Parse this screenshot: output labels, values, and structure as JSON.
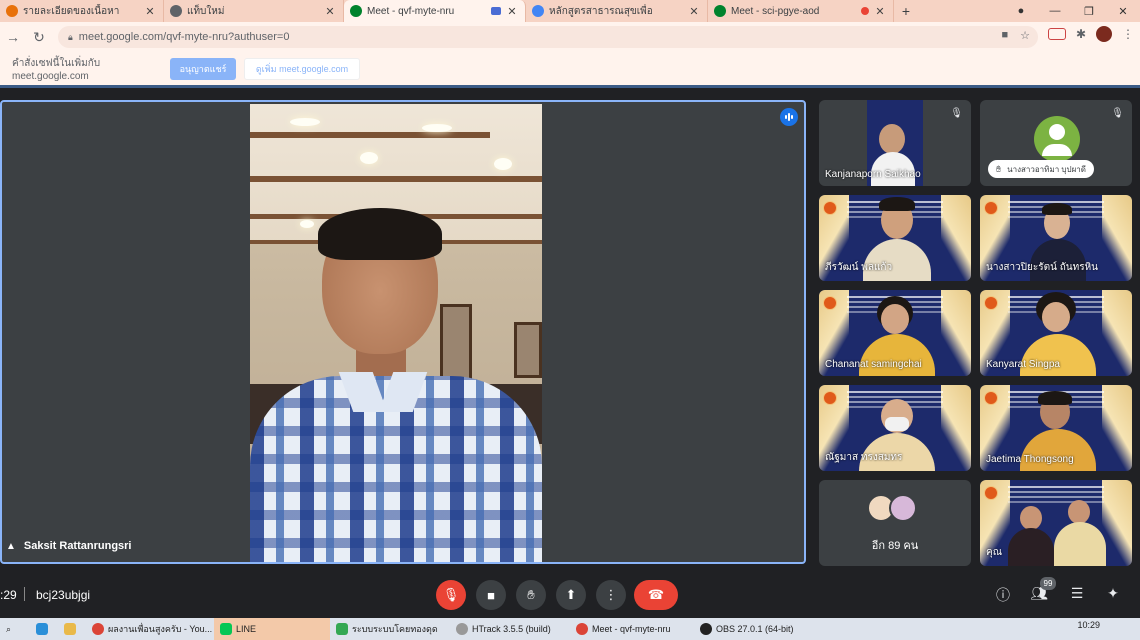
{
  "browser": {
    "tabs": [
      {
        "title": "รายละเอียดของเนื้อหา",
        "active": false,
        "favicon_color": "#e8710a"
      },
      {
        "title": "แท็บใหม่",
        "active": false,
        "favicon_color": "#5f6368"
      },
      {
        "title": "Meet - qvf-myte-nru",
        "active": true,
        "favicon_color": "#00832d"
      },
      {
        "title": "หลักสูตรสาธารณสุขเพื่อ",
        "active": false,
        "favicon_color": "#4285f4"
      },
      {
        "title": "Meet - sci-pgye-aod",
        "active": false,
        "favicon_color": "#00832d"
      }
    ],
    "new_tab": "+",
    "url": "meet.google.com/qvf-myte-nru?authuser=0",
    "infobar": {
      "message": "คำสั่งเซฟนี้ในเพิ่มกับ meet.google.com",
      "save_label": "อนุญาตแชร์",
      "never_label": "ดูเพิ่ม meet.google.com"
    }
  },
  "meet": {
    "main_speaker": "Saksit Rattanrungsri",
    "tiles": [
      {
        "name": "Kanjanaporn Saikhao",
        "muted": true
      },
      {
        "name": "นางสาวอาทิมา บุปผาดี",
        "muted": true,
        "hand_raised": true
      },
      {
        "name": "ภีรวัฒน์ พลแก้ว"
      },
      {
        "name": "นางสาวปิยะรัตน์ ถันทรหิน"
      },
      {
        "name": "Chananat samingchai"
      },
      {
        "name": "Kanyarat Singpa"
      },
      {
        "name": "ณัฐมาส ทรงสมทร"
      },
      {
        "name": "Jaetima Thongsong"
      },
      {
        "name": "คุณ"
      }
    ],
    "others": {
      "label": "อีก 89 คน"
    },
    "controls": {
      "time": ":29",
      "meeting_code": "bcj23ubjgi",
      "people_count": "99"
    }
  },
  "taskbar": {
    "items": [
      "ผลงานเพื่อนสูงครับ - You...",
      "LINE",
      "ระบบระบบโคยทองดุด",
      "HTrack 3.5.5 (build)",
      "Meet - qvf-myte-nru",
      "OBS 27.0.1 (64-bit)"
    ],
    "clock": "10:29"
  },
  "colors": {
    "accent": "#8ab4f8",
    "danger": "#ea4335",
    "background": "#202124",
    "tile": "#3c4043"
  }
}
